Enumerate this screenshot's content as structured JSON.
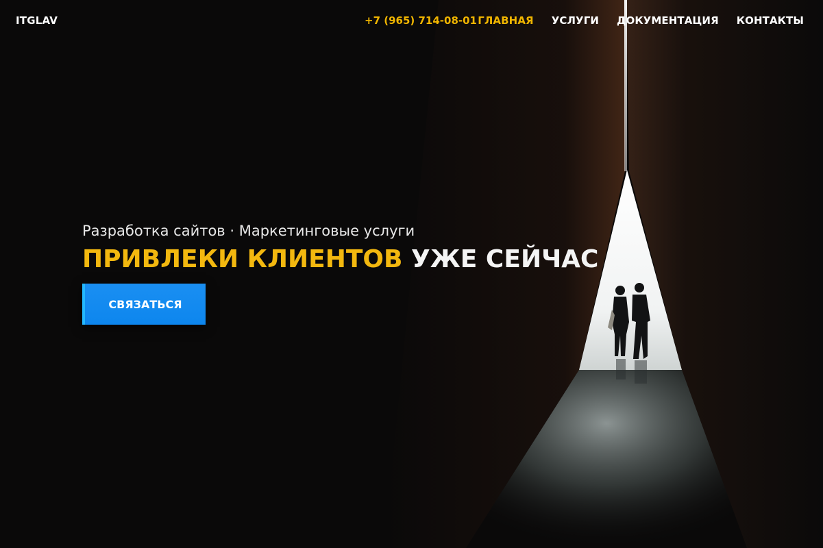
{
  "header": {
    "logo": "ITGLAV",
    "phone": "+7 (965) 714-08-01",
    "nav": [
      {
        "label": "ГЛАВНАЯ",
        "active": true
      },
      {
        "label": "УСЛУГИ",
        "active": false
      },
      {
        "label": "ДОКУМЕНТАЦИЯ",
        "active": false
      },
      {
        "label": "КОНТАКТЫ",
        "active": false
      }
    ]
  },
  "hero": {
    "subtitle": "Разработка сайтов · Маркетинговые услуги",
    "headline_accent": "ПРИВЛЕКИ КЛИЕНТОВ",
    "headline_plain": "УЖЕ СЕЙЧАС",
    "cta_label": "СВЯЗАТЬСЯ",
    "image": "corridor-with-light-gap-and-two-people"
  },
  "colors": {
    "accent": "#f0b500",
    "button": "#0d86ee",
    "background": "#0a0909"
  }
}
